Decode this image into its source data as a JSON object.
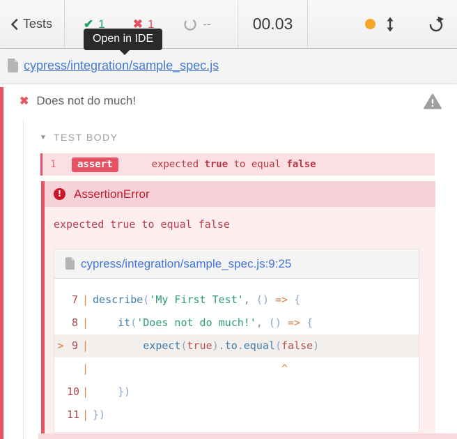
{
  "topbar": {
    "back_label": "Tests",
    "passed_count": "1",
    "failed_count": "1",
    "pending_count": "--",
    "duration": "00.03",
    "tooltip": "Open in IDE"
  },
  "file_link": "cypress/integration/sample_spec.js",
  "test": {
    "title": "Does not do much!",
    "section_label": "TEST BODY",
    "command": {
      "number": "1",
      "name": "assert",
      "message_parts": [
        {
          "text": "expected ",
          "bold": false
        },
        {
          "text": "true",
          "bold": true
        },
        {
          "text": " to equal ",
          "bold": false
        },
        {
          "text": "false",
          "bold": true
        }
      ]
    },
    "error": {
      "name": "AssertionError",
      "message": "expected true to equal false",
      "frame_link": "cypress/integration/sample_spec.js:9:25"
    }
  },
  "code": {
    "gutter_pipe": "|",
    "lines": [
      {
        "number": "7",
        "marker": "",
        "highlight": false,
        "tokens": [
          {
            "t": "describe",
            "c": "fn"
          },
          {
            "t": "(",
            "c": "br"
          },
          {
            "t": "'My First Test'",
            "c": "str"
          },
          {
            "t": ", ",
            "c": "pl"
          },
          {
            "t": "()",
            "c": "br"
          },
          {
            "t": " ",
            "c": "pl"
          },
          {
            "t": "=>",
            "c": "op"
          },
          {
            "t": " ",
            "c": "pl"
          },
          {
            "t": "{",
            "c": "br"
          }
        ]
      },
      {
        "number": "8",
        "marker": "",
        "highlight": false,
        "tokens": [
          {
            "t": "    ",
            "c": "pl"
          },
          {
            "t": "it",
            "c": "fn"
          },
          {
            "t": "(",
            "c": "br"
          },
          {
            "t": "'Does not do much!'",
            "c": "str"
          },
          {
            "t": ", ",
            "c": "pl"
          },
          {
            "t": "()",
            "c": "br"
          },
          {
            "t": " ",
            "c": "pl"
          },
          {
            "t": "=>",
            "c": "op"
          },
          {
            "t": " ",
            "c": "pl"
          },
          {
            "t": "{",
            "c": "br"
          }
        ]
      },
      {
        "number": "9",
        "marker": ">",
        "highlight": true,
        "tokens": [
          {
            "t": "        ",
            "c": "pl"
          },
          {
            "t": "expect",
            "c": "fn"
          },
          {
            "t": "(",
            "c": "br"
          },
          {
            "t": "true",
            "c": "bool"
          },
          {
            "t": ")",
            "c": "br"
          },
          {
            "t": ".",
            "c": "pl"
          },
          {
            "t": "to",
            "c": "fn"
          },
          {
            "t": ".",
            "c": "pl"
          },
          {
            "t": "equal",
            "c": "fn"
          },
          {
            "t": "(",
            "c": "br"
          },
          {
            "t": "false",
            "c": "bool"
          },
          {
            "t": ")",
            "c": "br"
          }
        ]
      },
      {
        "number": "",
        "marker": "",
        "highlight": false,
        "tokens": [
          {
            "t": "                              ^",
            "c": "op"
          }
        ]
      },
      {
        "number": "10",
        "marker": "",
        "highlight": false,
        "tokens": [
          {
            "t": "    ",
            "c": "pl"
          },
          {
            "t": "})",
            "c": "br"
          }
        ]
      },
      {
        "number": "11",
        "marker": "",
        "highlight": false,
        "tokens": [
          {
            "t": "})",
            "c": "br"
          }
        ]
      }
    ]
  },
  "colors": {
    "accent_red": "#e45464",
    "pass_green": "#1da065",
    "fail_red": "#e4505c",
    "pending_orange": "#f5a62a",
    "link_blue": "#4679d2",
    "command_bg": "#fbdfe3",
    "error_header_bg": "#f6d2d8",
    "error_body_bg": "#fcedef"
  }
}
